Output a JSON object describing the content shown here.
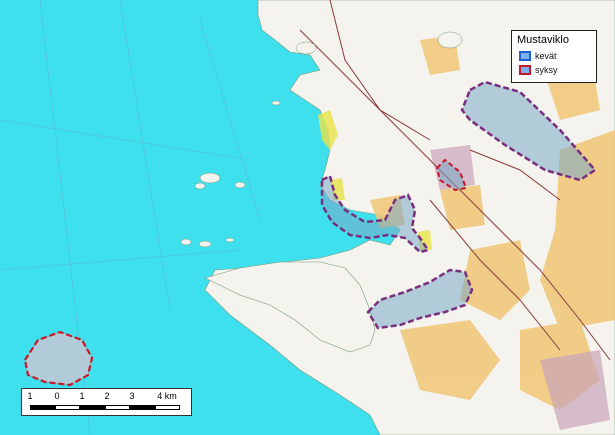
{
  "legend": {
    "title": "Mustaviklo",
    "items": [
      {
        "label": "kevät",
        "color": "#1f5fd8"
      },
      {
        "label": "syksy",
        "color": "#c9182a"
      }
    ]
  },
  "scalebar": {
    "ticks": [
      "1",
      "0",
      "1",
      "2",
      "3",
      "4 km"
    ]
  },
  "colors": {
    "sea": "#3fe0ee",
    "land": "#f4f3ee",
    "forest": "#f0c676",
    "area_fill": "#7aa9c9"
  }
}
